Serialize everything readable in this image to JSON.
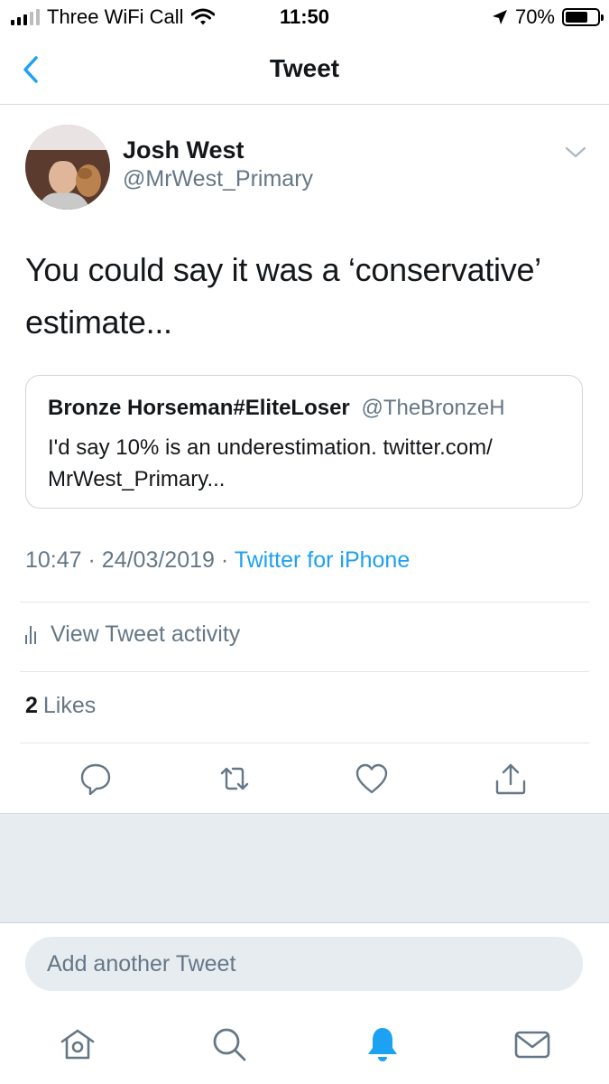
{
  "status_bar": {
    "carrier": "Three WiFi Call",
    "time": "11:50",
    "battery": "70%",
    "battery_level": 0.7
  },
  "nav": {
    "title": "Tweet",
    "back_icon": "chevron-left-icon"
  },
  "tweet": {
    "author_name": "Josh West",
    "author_handle": "@MrWest_Primary",
    "text": "You could say it was a ‘conservative’ estimate...",
    "quote": {
      "name": "Bronze Horseman#EliteLoser",
      "handle": "@TheBronzeH",
      "text": "I'd say 10% is an underestimation. twitter.com/ MrWest_Primary..."
    },
    "time": "10:47",
    "separator": "·",
    "date": "24/03/2019",
    "source": "Twitter for iPhone",
    "activity_label": "View Tweet activity",
    "likes_count": "2",
    "likes_label": "Likes"
  },
  "actions": {
    "reply_icon": "reply-icon",
    "retweet_icon": "retweet-icon",
    "like_icon": "heart-icon",
    "share_icon": "share-icon"
  },
  "compose": {
    "placeholder": "Add another Tweet"
  },
  "tab_bar": {
    "items": [
      "home-icon",
      "search-icon",
      "notifications-icon",
      "messages-icon"
    ],
    "active": "notifications-icon"
  },
  "colors": {
    "accent": "#1da1f2",
    "secondary_text": "#657786",
    "border": "#e1e8ed",
    "gray_background": "#e6ecf0"
  }
}
